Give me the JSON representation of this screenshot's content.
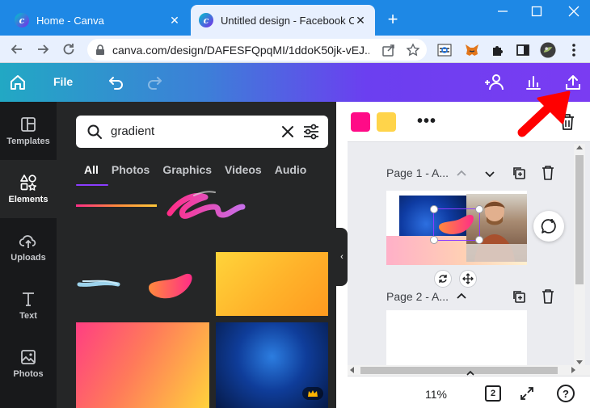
{
  "browser": {
    "tabs": [
      {
        "title": "Home - Canva",
        "favicon": "canva-favicon-icon"
      },
      {
        "title": "Untitled design - Facebook Co",
        "favicon": "canva-favicon-icon",
        "active": true
      }
    ],
    "url": "canva.com/design/DAFESFQpqMI/1ddoK50jk-vEJ...",
    "tabbar_color": "#1e88e5"
  },
  "canva_header": {
    "file_label": "File",
    "icons": [
      "home-icon",
      "undo-icon",
      "redo-icon",
      "share-people-icon",
      "insights-icon",
      "share-upload-icon"
    ]
  },
  "rail": {
    "items": [
      {
        "label": "Templates",
        "icon": "templates-icon"
      },
      {
        "label": "Elements",
        "icon": "elements-icon",
        "active": true
      },
      {
        "label": "Uploads",
        "icon": "uploads-icon"
      },
      {
        "label": "Text",
        "icon": "text-icon"
      },
      {
        "label": "Photos",
        "icon": "photos-icon"
      }
    ]
  },
  "panel": {
    "search_value": "gradient",
    "categories": [
      "All",
      "Photos",
      "Graphics",
      "Videos",
      "Audio"
    ],
    "active_category": "All",
    "accent": "#8b3dff"
  },
  "editor": {
    "swatches": [
      "#ff0b87",
      "#ffd44a"
    ],
    "pages": [
      {
        "label": "Page 1 - A..."
      },
      {
        "label": "Page 2 - A..."
      }
    ],
    "zoom": "11%",
    "page_count": "2",
    "help_label": "?"
  }
}
